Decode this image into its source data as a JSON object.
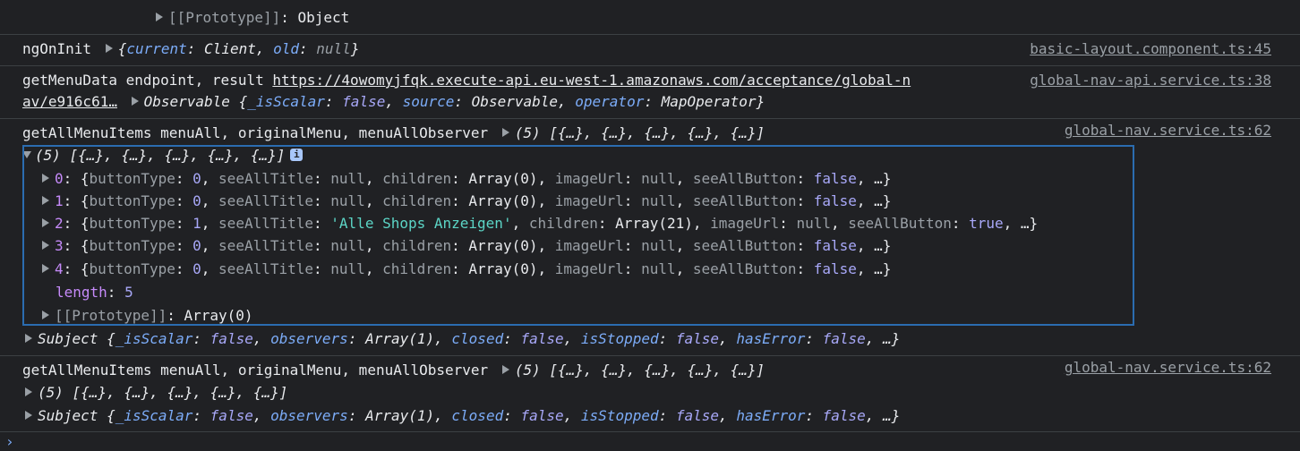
{
  "lines": {
    "proto_top": {
      "label": "[[Prototype]]",
      "value": "Object"
    },
    "ngoninit": {
      "label": "ngOnInit",
      "obj": {
        "current_key": "current",
        "current_val": "Client",
        "old_key": "old",
        "old_val": "null"
      },
      "src": "basic-layout.component.ts:45"
    },
    "getmenudata": {
      "label": "getMenuData endpoint, result",
      "url_line1": "https://4owomyjfqk.execute-api.eu-west-1.amazonaws.com/acceptance/global-n",
      "url_line2": "av/e916c61…",
      "src": "global-nav-api.service.ts:38",
      "observable": {
        "type": "Observable",
        "k1": "_isScalar",
        "v1": "false",
        "k2": "source",
        "v2": "Observable",
        "k3": "operator",
        "v3": "MapOperator"
      }
    },
    "getall1": {
      "label": "getAllMenuItems menuAll, originalMenu, menuAllObserver",
      "summary": "(5) [{…}, {…}, {…}, {…}, {…}]",
      "src": "global-nav.service.ts:62"
    },
    "array_expanded": {
      "summary": "(5) [{…}, {…}, {…}, {…}, {…}]",
      "info": "i",
      "items": [
        {
          "idx": "0",
          "buttonType": "0",
          "seeAllTitle": "null",
          "children": "Array(0)",
          "imageUrl": "null",
          "seeAllButton": "false"
        },
        {
          "idx": "1",
          "buttonType": "0",
          "seeAllTitle": "null",
          "children": "Array(0)",
          "imageUrl": "null",
          "seeAllButton": "false"
        },
        {
          "idx": "2",
          "buttonType": "1",
          "seeAllTitle": "'Alle Shops Anzeigen'",
          "children": "Array(21)",
          "imageUrl": "null",
          "seeAllButton": "true"
        },
        {
          "idx": "3",
          "buttonType": "0",
          "seeAllTitle": "null",
          "children": "Array(0)",
          "imageUrl": "null",
          "seeAllButton": "false"
        },
        {
          "idx": "4",
          "buttonType": "0",
          "seeAllTitle": "null",
          "children": "Array(0)",
          "imageUrl": "null",
          "seeAllButton": "false"
        }
      ],
      "length_key": "length",
      "length_val": "5",
      "proto_key": "[[Prototype]]",
      "proto_val": "Array(0)"
    },
    "subject1": {
      "type": "Subject",
      "k1": "_isScalar",
      "v1": "false",
      "k2": "observers",
      "v2": "Array(1)",
      "k3": "closed",
      "v3": "false",
      "k4": "isStopped",
      "v4": "false",
      "k5": "hasError",
      "v5": "false"
    },
    "getall2": {
      "label": "getAllMenuItems menuAll, originalMenu, menuAllObserver",
      "summary": "(5) [{…}, {…}, {…}, {…}, {…}]",
      "src": "global-nav.service.ts:62"
    },
    "array_collapsed": {
      "summary": "(5) [{…}, {…}, {…}, {…}, {…}]"
    },
    "subject2": {
      "type": "Subject",
      "k1": "_isScalar",
      "v1": "false",
      "k2": "observers",
      "v2": "Array(1)",
      "k3": "closed",
      "v3": "false",
      "k4": "isStopped",
      "v4": "false",
      "k5": "hasError",
      "v5": "false"
    }
  },
  "keys": {
    "buttonType": "buttonType",
    "seeAllTitle": "seeAllTitle",
    "children": "children",
    "imageUrl": "imageUrl",
    "seeAllButton": "seeAllButton"
  },
  "prompt": "›"
}
